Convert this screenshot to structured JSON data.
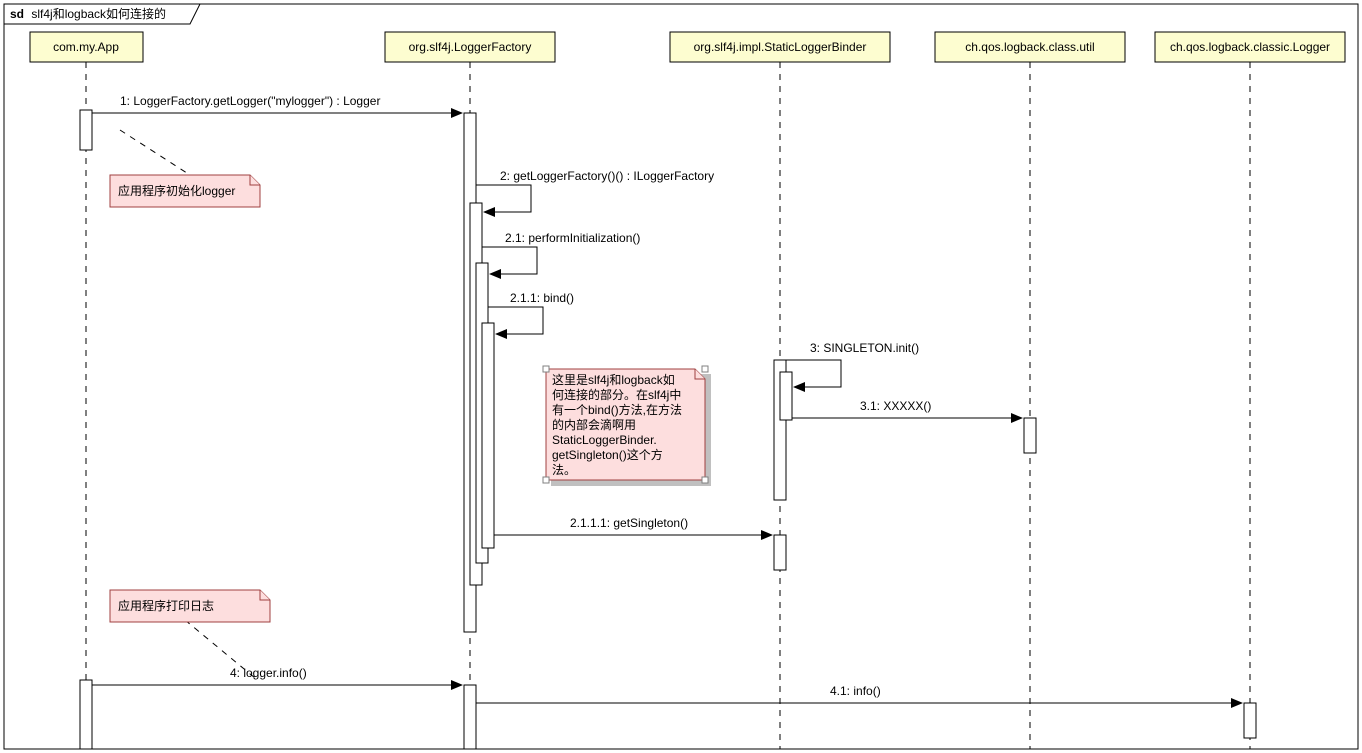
{
  "frame": {
    "prefix": "sd",
    "title": "slf4j和logback如何连接的"
  },
  "participants": [
    {
      "id": "app",
      "label": "com.my.App"
    },
    {
      "id": "lf",
      "label": "org.slf4j.LoggerFactory"
    },
    {
      "id": "slb",
      "label": "org.slf4j.impl.StaticLoggerBinder"
    },
    {
      "id": "util",
      "label": "ch.qos.logback.class.util"
    },
    {
      "id": "logger",
      "label": "ch.qos.logback.classic.Logger"
    }
  ],
  "messages": {
    "m1": "1: LoggerFactory.getLogger(\"mylogger\") : Logger",
    "m2": "2: getLoggerFactory()() : ILoggerFactory",
    "m21": "2.1: performInitialization()",
    "m211": "2.1.1: bind()",
    "m3": "3: SINGLETON.init()",
    "m31": "3.1: XXXXX()",
    "m2111": "2.1.1.1: getSingleton()",
    "m4": "4: logger.info()",
    "m41": "4.1: info()"
  },
  "notes": {
    "n1": "应用程序初始化logger",
    "n2_line1": "这里是slf4j和logback如",
    "n2_line2": "何连接的部分。在slf4j中",
    "n2_line3": "有一个bind()方法,在方法",
    "n2_line4": "的内部会滴啊用",
    "n2_line5": "StaticLoggerBinder.",
    "n2_line6": "getSingleton()这个方",
    "n2_line7": "法。",
    "n3": "应用程序打印日志"
  }
}
